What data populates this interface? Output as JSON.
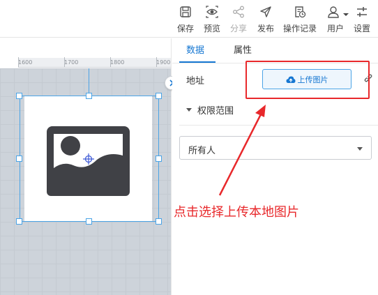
{
  "toolbar": {
    "items": [
      {
        "label": "保存",
        "icon": "save-icon"
      },
      {
        "label": "预览",
        "icon": "preview-eye-icon"
      },
      {
        "label": "分享",
        "icon": "share-icon"
      },
      {
        "label": "发布",
        "icon": "publish-send-icon"
      },
      {
        "label": "操作记录",
        "icon": "history-icon"
      },
      {
        "label": "用户",
        "icon": "user-icon"
      },
      {
        "label": "设置",
        "icon": "settings-sliders-icon"
      }
    ]
  },
  "canvas": {
    "ruler_ticks": [
      "1600",
      "1700",
      "1800",
      "1900"
    ],
    "image_placeholder_icon": "image-placeholder-icon"
  },
  "panel": {
    "tabs": [
      {
        "label": "数据",
        "active": true
      },
      {
        "label": "属性",
        "active": false
      }
    ],
    "address_label": "地址",
    "upload_button_label": "上传图片",
    "permission_label": "权限范围",
    "permission_value": "所有人"
  },
  "annotation": {
    "text": "点击选择上传本地图片",
    "color": "#e8282b"
  },
  "colors": {
    "accent": "#1677d2",
    "selection": "#4aa3e6",
    "annotation": "#e8282b"
  }
}
